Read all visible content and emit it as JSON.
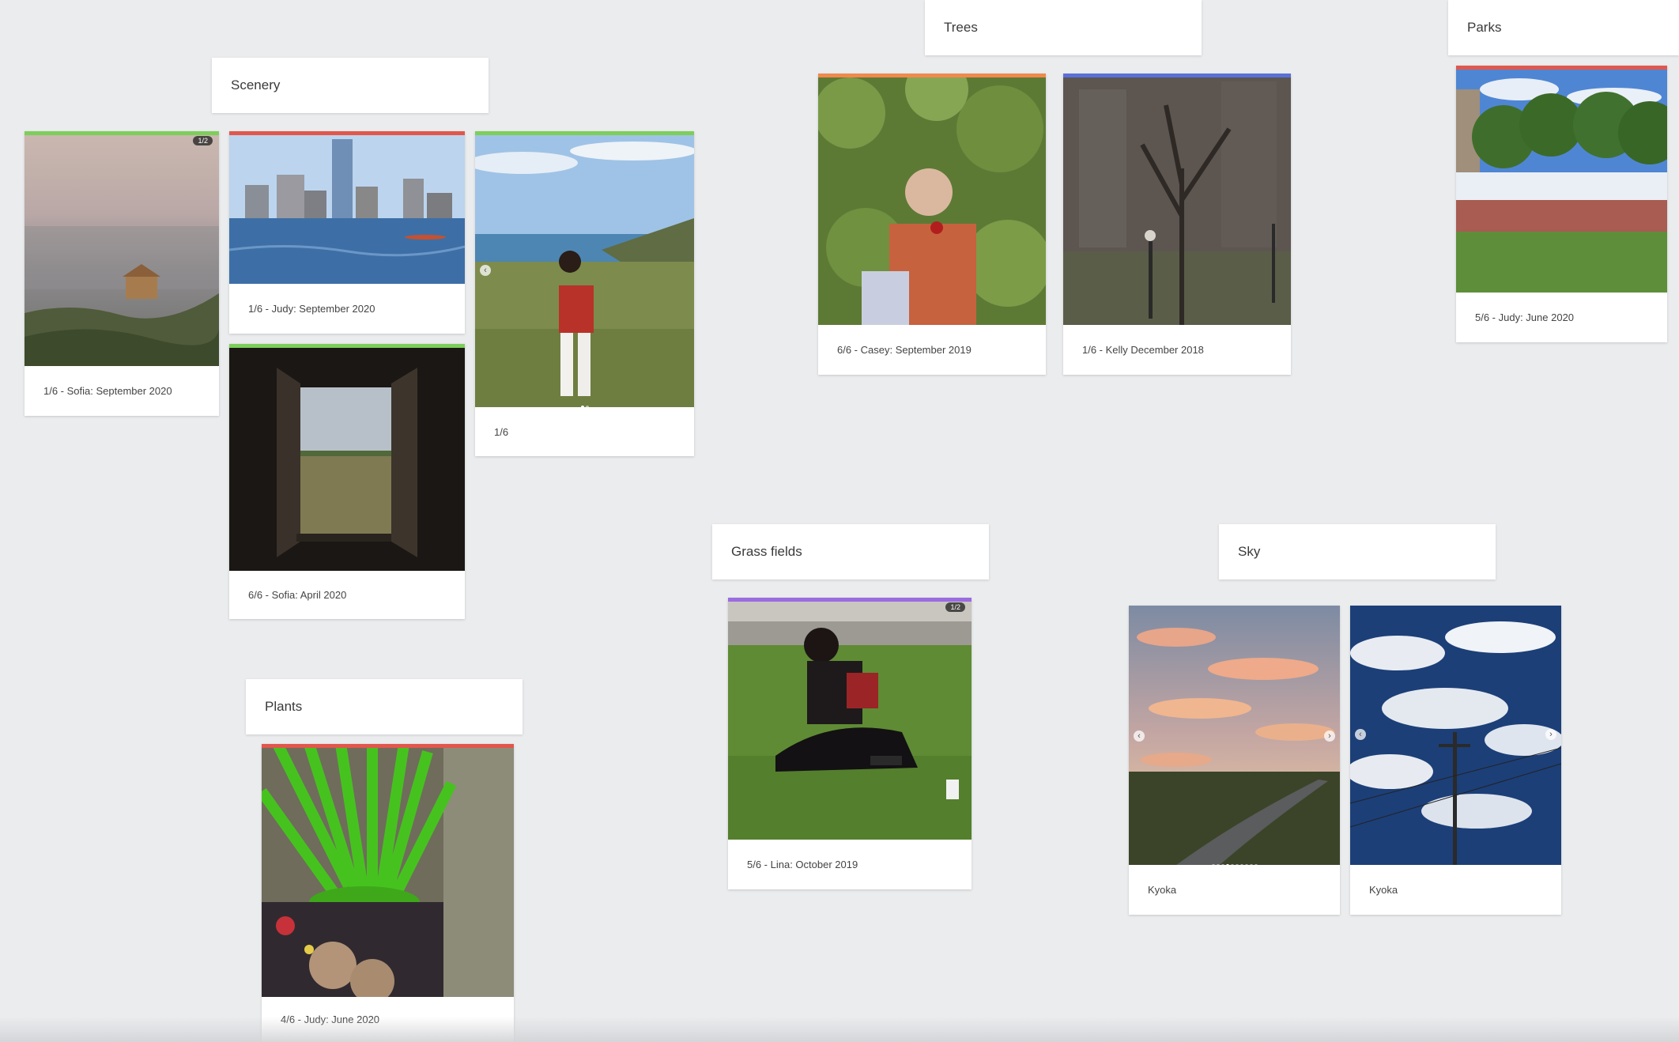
{
  "groups": {
    "scenery": "Scenery",
    "trees": "Trees",
    "parks": "Parks",
    "grass": "Grass fields",
    "sky": "Sky",
    "plants": "Plants"
  },
  "cards": {
    "sofia_sunset": {
      "caption": "1/6 - Sofia: September 2020",
      "badge": "1/2",
      "stripe": "#7dcf5a"
    },
    "judy_skyline": {
      "caption": "1/6 - Judy: September 2020",
      "stripe": "#e2574c"
    },
    "sofia_window": {
      "caption": "6/6 - Sofia: April 2020",
      "stripe": "#7dcf5a"
    },
    "girl_coast": {
      "caption": "1/6",
      "stripe": "#7dcf5a"
    },
    "casey_tree": {
      "caption": "6/6 - Casey: September 2019",
      "stripe": "#ef8a4c"
    },
    "kelly_tree": {
      "caption": "1/6 - Kelly December 2018",
      "stripe": "#5a6fd8"
    },
    "judy_fountain": {
      "caption": "5/6 - Judy: June 2020",
      "stripe": "#e2574c"
    },
    "lina_grass": {
      "caption": "5/6 - Lina: October 2019",
      "badge": "1/2",
      "stripe": "#9b6be0"
    },
    "kyoka_sunset": {
      "caption": "Kyoka"
    },
    "kyoka_clouds": {
      "caption": "Kyoka"
    },
    "judy_plant": {
      "caption": "4/6 - Judy: June 2020",
      "stripe": "#e2574c"
    }
  },
  "icons": {
    "prev": "‹",
    "next": "›"
  }
}
